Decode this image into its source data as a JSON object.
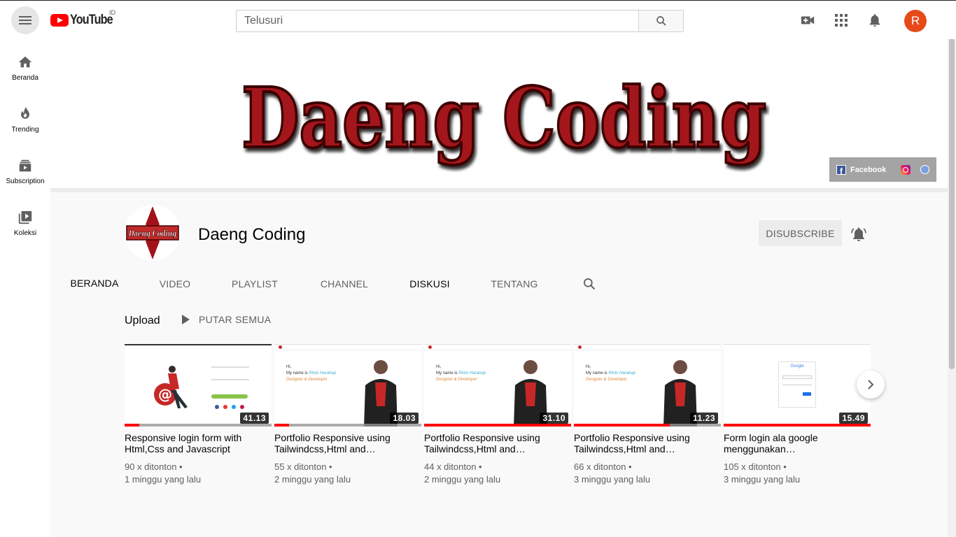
{
  "header": {
    "logo_text": "YouTube",
    "region": "ID",
    "search_placeholder": "Telusuri",
    "avatar_letter": "R",
    "avatar_color": "#e64a19"
  },
  "guide": {
    "items": [
      {
        "label": "Beranda",
        "icon": "home-icon"
      },
      {
        "label": "Trending",
        "icon": "flame-icon"
      },
      {
        "label": "Subscription",
        "icon": "subscriptions-icon"
      },
      {
        "label": "Koleksi",
        "icon": "library-icon"
      }
    ]
  },
  "banner": {
    "title": "Daeng Coding",
    "link_facebook": "Facebook"
  },
  "channel": {
    "name": "Daeng Coding",
    "avatar_text": "Daeng Coding",
    "subscribe_label": "DISUBSCRIBE",
    "tabs": [
      "BERANDA",
      "VIDEO",
      "PLAYLIST",
      "CHANNEL",
      "DISKUSI",
      "TENTANG"
    ]
  },
  "section": {
    "title": "Upload",
    "play_all": "PUTAR SEMUA",
    "videos": [
      {
        "title": "Responsive login form with Html,Css and Javascript",
        "views": "90 x ditonton •",
        "age": "1 minggu yang lalu",
        "duration": "41.13",
        "progress": 0.1
      },
      {
        "title": "Portfolio Responsive using Tailwindcss,Html and…",
        "views": "55 x ditonton •",
        "age": "2 minggu yang lalu",
        "duration": "18.03",
        "progress": 0.1
      },
      {
        "title": "Portfolio Responsive using Tailwindcss,Html and…",
        "views": "44 x ditonton •",
        "age": "2 minggu yang lalu",
        "duration": "31.10",
        "progress": 1.0
      },
      {
        "title": "Portfolio Responsive using Tailwindcss,Html and…",
        "views": "66 x ditonton •",
        "age": "3 minggu yang lalu",
        "duration": "11.23",
        "progress": 0.65
      },
      {
        "title": "Form login ala google menggunakan…",
        "views": "105 x ditonton •",
        "age": "3 minggu yang lalu",
        "duration": "15.49",
        "progress": 1.0
      }
    ],
    "thumb_text": {
      "hi": "Hi,",
      "name_prefix": "My name is",
      "name": "Rinto Harahap",
      "role": "Designer & Developer",
      "google": "Google"
    }
  },
  "colors": {
    "brand_red": "#ff0000",
    "banner_red": "#a3121a",
    "text_secondary": "#606060"
  }
}
